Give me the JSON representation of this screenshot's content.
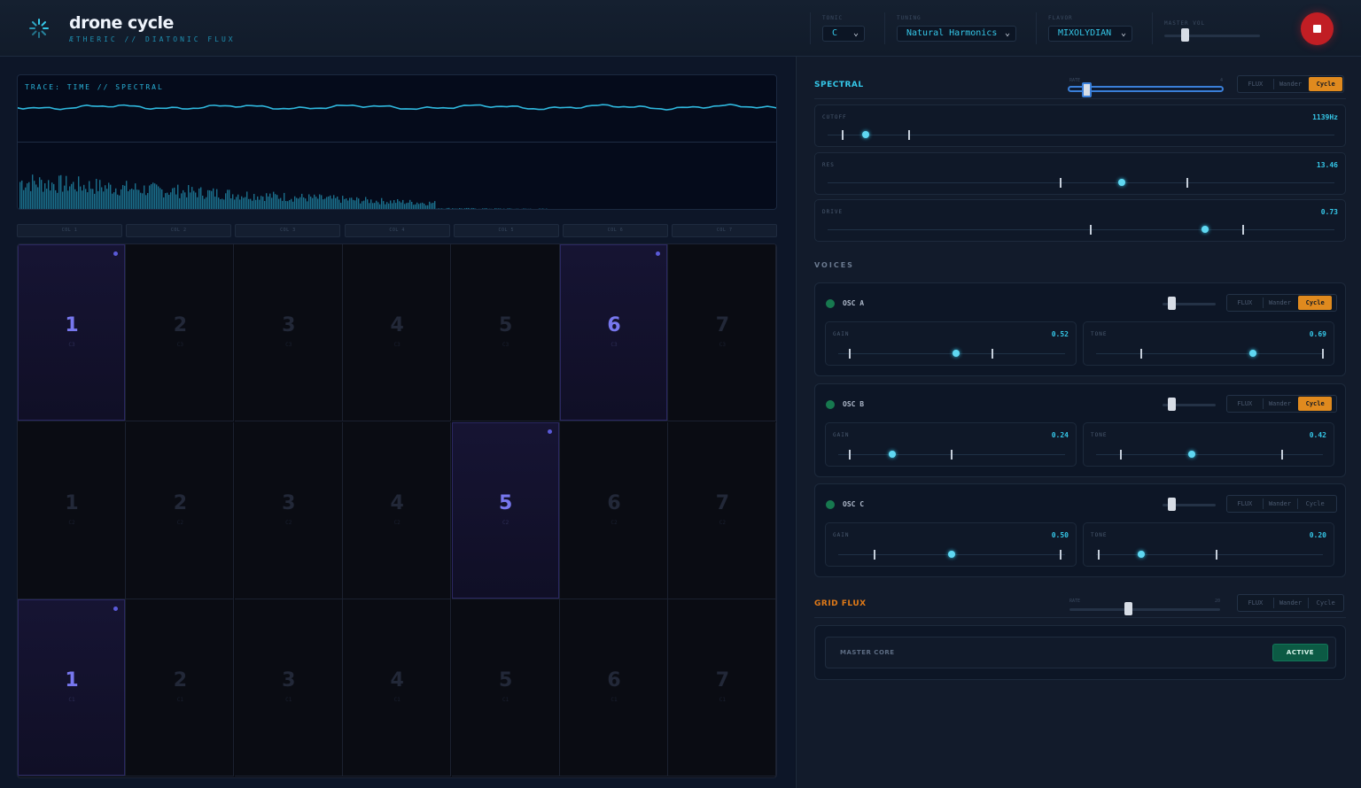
{
  "header": {
    "title": "drone cycle",
    "subtitle": "ÆTHERIC // DIATONIC FLUX",
    "tonic_label": "TONIC",
    "tonic_value": "C",
    "tuning_label": "TUNING",
    "tuning_value": "Natural Harmonics",
    "flavor_label": "FLAVOR",
    "flavor_value": "MIXOLYDIAN",
    "master_vol_label": "MASTER VOL",
    "master_vol_level": 0.22
  },
  "trace": {
    "label": "TRACE: TIME // SPECTRAL"
  },
  "columns": [
    "COL 1",
    "COL 2",
    "COL 3",
    "COL 4",
    "COL 5",
    "COL 6",
    "COL 7"
  ],
  "grid": {
    "rows": [
      {
        "note": "C3",
        "cells": [
          {
            "n": "1",
            "active": true
          },
          {
            "n": "2",
            "active": false
          },
          {
            "n": "3",
            "active": false
          },
          {
            "n": "4",
            "active": false
          },
          {
            "n": "5",
            "active": false
          },
          {
            "n": "6",
            "active": true
          },
          {
            "n": "7",
            "active": false
          }
        ]
      },
      {
        "note": "C2",
        "cells": [
          {
            "n": "1",
            "active": false
          },
          {
            "n": "2",
            "active": false
          },
          {
            "n": "3",
            "active": false
          },
          {
            "n": "4",
            "active": false
          },
          {
            "n": "5",
            "active": true
          },
          {
            "n": "6",
            "active": false
          },
          {
            "n": "7",
            "active": false
          }
        ]
      },
      {
        "note": "C1",
        "cells": [
          {
            "n": "1",
            "active": true
          },
          {
            "n": "2",
            "active": false
          },
          {
            "n": "3",
            "active": false
          },
          {
            "n": "4",
            "active": false
          },
          {
            "n": "5",
            "active": false
          },
          {
            "n": "6",
            "active": false
          },
          {
            "n": "7",
            "active": false
          }
        ]
      }
    ]
  },
  "mode_options": [
    "FLUX",
    "Wander",
    "Cycle"
  ],
  "spectral": {
    "title": "SPECTRAL",
    "rate_label": "RATE",
    "rate_max": "4",
    "rate_level": 0.12,
    "mode": "Cycle",
    "params": [
      {
        "label": "CUTOFF",
        "value": "1139Hz",
        "min": 0.03,
        "max": 0.16,
        "pos": 0.075
      },
      {
        "label": "RES",
        "value": "13.46",
        "min": 0.46,
        "max": 0.71,
        "pos": 0.58
      },
      {
        "label": "DRIVE",
        "value": "0.73",
        "min": 0.52,
        "max": 0.82,
        "pos": 0.745
      }
    ]
  },
  "voices_title": "VOICES",
  "voices": [
    {
      "name": "OSC A",
      "mode": "Cycle",
      "level": 0.18,
      "gain": {
        "label": "GAIN",
        "value": "0.52",
        "min": 0.05,
        "max": 0.68,
        "pos": 0.52
      },
      "tone": {
        "label": "TONE",
        "value": "0.69",
        "min": 0.2,
        "max": 1.0,
        "pos": 0.69
      }
    },
    {
      "name": "OSC B",
      "mode": "Cycle",
      "level": 0.18,
      "gain": {
        "label": "GAIN",
        "value": "0.24",
        "min": 0.05,
        "max": 0.5,
        "pos": 0.24
      },
      "tone": {
        "label": "TONE",
        "value": "0.42",
        "min": 0.11,
        "max": 0.82,
        "pos": 0.42
      }
    },
    {
      "name": "OSC C",
      "mode": "none",
      "level": 0.18,
      "gain": {
        "label": "GAIN",
        "value": "0.50",
        "min": 0.16,
        "max": 0.98,
        "pos": 0.5
      },
      "tone": {
        "label": "TONE",
        "value": "0.20",
        "min": 0.01,
        "max": 0.53,
        "pos": 0.2
      }
    }
  ],
  "grid_flux": {
    "title": "GRID FLUX",
    "rate_label": "RATE",
    "rate_max": "20",
    "rate_level": 0.39,
    "mode": "none"
  },
  "master_core": {
    "label": "MASTER CORE",
    "button": "ACTIVE"
  },
  "colors": {
    "accent": "#35c7e8",
    "cycle": "#e08a1e",
    "grid_flux": "#e07a18",
    "active_cell": "#7777ee",
    "stop": "#c11e24",
    "led": "#17794f"
  }
}
